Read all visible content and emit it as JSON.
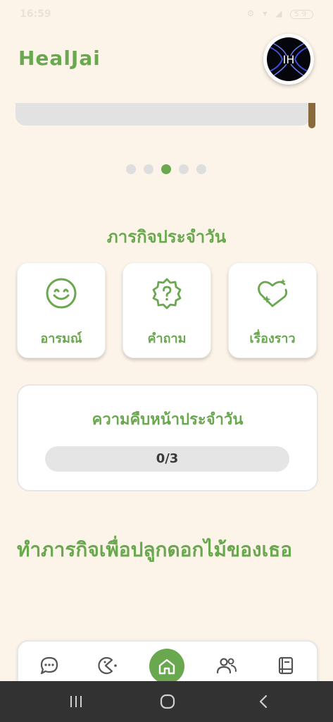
{
  "status_bar": {
    "time": "16:59",
    "icons": "⚙ ▾ ◢",
    "battery": "59"
  },
  "header": {
    "app_title": "HealJai",
    "avatar_text": "IH"
  },
  "carousel": {
    "page_count": 5,
    "active_index": 2
  },
  "missions": {
    "title": "ภารกิจประจำวัน",
    "cards": [
      {
        "label": "อารมณ์",
        "icon": "smile-icon"
      },
      {
        "label": "คำถาม",
        "icon": "question-badge-icon"
      },
      {
        "label": "เรื่องราว",
        "icon": "sparkle-heart-icon"
      }
    ]
  },
  "progress": {
    "title": "ความคืบหน้าประจำวัน",
    "text": "0/3",
    "completed": 0,
    "total": 3
  },
  "grow": {
    "title": "ทำภารกิจเพื่อปลูกดอกไม้ของเธอ"
  },
  "bottom_nav": {
    "items": [
      {
        "name": "chat-icon"
      },
      {
        "name": "game-icon"
      },
      {
        "name": "home-icon",
        "active": true
      },
      {
        "name": "friends-icon"
      },
      {
        "name": "book-icon"
      }
    ]
  },
  "system_nav": {
    "recents": "|||",
    "home": "○",
    "back": "‹"
  },
  "colors": {
    "accent": "#6aa84f",
    "background": "#fdf4e9",
    "track": "#e5e5e5"
  }
}
